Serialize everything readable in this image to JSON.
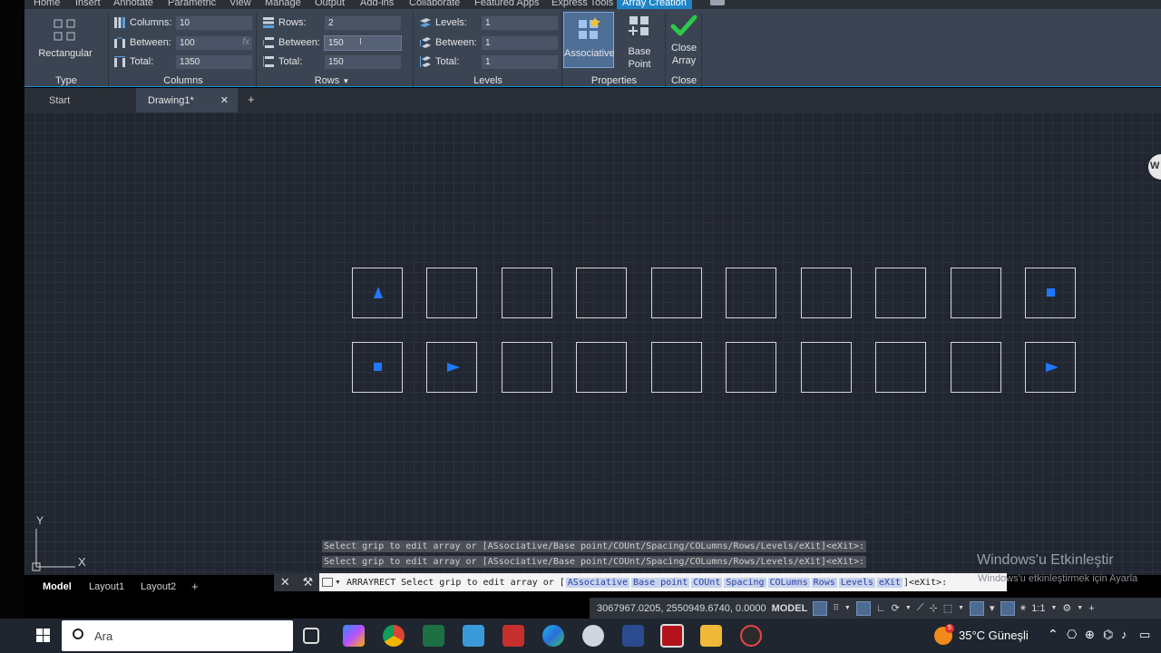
{
  "ribbon_tabs": [
    "Home",
    "Insert",
    "Annotate",
    "Parametric",
    "View",
    "Manage",
    "Output",
    "Add-ins",
    "Collaborate",
    "Featured Apps",
    "Express Tools",
    "Array Creation"
  ],
  "type_panel": {
    "button": "Rectangular",
    "title": "Type"
  },
  "columns_panel": {
    "title": "Columns",
    "fields": [
      {
        "label": "Columns:",
        "value": "10"
      },
      {
        "label": "Between:",
        "value": "100"
      },
      {
        "label": "Total:",
        "value": "1350"
      }
    ],
    "fx": "fx"
  },
  "rows_panel": {
    "title": "Rows",
    "fields": [
      {
        "label": "Rows:",
        "value": "2"
      },
      {
        "label": "Between:",
        "value": "150"
      },
      {
        "label": "Total:",
        "value": "150"
      }
    ]
  },
  "levels_panel": {
    "title": "Levels",
    "fields": [
      {
        "label": "Levels:",
        "value": "1"
      },
      {
        "label": "Between:",
        "value": "1"
      },
      {
        "label": "Total:",
        "value": "1"
      }
    ]
  },
  "properties_panel": {
    "associative": "Associative",
    "base_point": "Base Point",
    "title": "Properties"
  },
  "close_panel": {
    "close_line1": "Close",
    "close_line2": "Array",
    "title": "Close"
  },
  "file_tabs": {
    "start": "Start",
    "drawing": "Drawing1*",
    "close": "✕",
    "add": "+"
  },
  "ucs": {
    "y": "Y",
    "x": "X"
  },
  "command": {
    "history1": "Select grip to edit array or [ASsociative/Base point/COUnt/Spacing/COLumns/Rows/Levels/eXit]<eXit>:",
    "history2": "Select grip to edit array or [ASsociative/Base point/COUnt/Spacing/COLumns/Rows/Levels/eXit]<eXit>:",
    "prompt_cmd": "ARRAYRECT",
    "prompt_text": "Select grip to edit array or [",
    "options": [
      "ASsociative",
      "Base point",
      "COUnt",
      "Spacing",
      "COLumns",
      "Rows",
      "Levels",
      "eXit"
    ],
    "prompt_end": "]<eXit>:"
  },
  "watermark": {
    "title": "Windows'u Etkinleştir",
    "subtitle": "Windows'u etkinleştirmek için Ayarla"
  },
  "layout_tabs": {
    "model": "Model",
    "layout1": "Layout1",
    "layout2": "Layout2",
    "add": "+"
  },
  "status": {
    "coords": "3067967.0205, 2550949.6740, 0.0000",
    "space": "MODEL",
    "scale": "1:1"
  },
  "taskbar": {
    "search_placeholder": "Ara",
    "temperature": "35°C Güneşli",
    "weather_badge": "5"
  },
  "colors": {
    "grip": "#1f78ff",
    "accent": "#1e84c6",
    "close_check": "#2ec84a"
  }
}
